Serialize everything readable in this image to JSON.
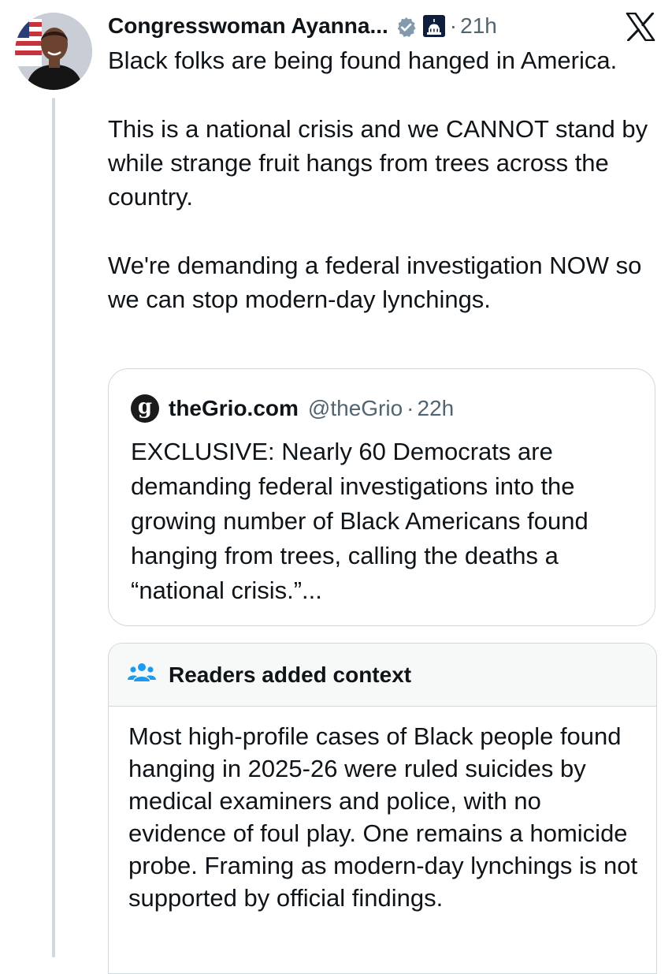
{
  "tweet": {
    "author_name": "Congresswoman Ayanna...",
    "time_ago": "21h",
    "separator": "·",
    "paragraphs": [
      "Black folks are being found hanged in America.",
      "This is a national crisis and we CANNOT stand by while strange fruit hangs from trees across the country.",
      "We're demanding a federal investigation NOW so we can stop modern-day lynchings."
    ],
    "icons": {
      "verified": "verified-badge-icon",
      "affiliation": "capitol-building-icon",
      "platform": "x-logo-icon"
    }
  },
  "quoted_tweet": {
    "logo_letter": "g",
    "name": "theGrio.com",
    "handle": "@theGrio",
    "time_ago": "22h",
    "separator": "·",
    "text": "EXCLUSIVE: Nearly 60 Democrats are demanding federal investigations into the growing number of Black Americans found hanging from trees, calling the deaths a “national crisis.”..."
  },
  "community_note": {
    "title": "Readers added context",
    "icon": "people-group-icon",
    "body": "Most high-profile cases of Black people found hanging in 2025-26 were ruled suicides by medical examiners and police, with no evidence of foul play. One remains a homicide probe. Framing as modern-day lynchings is not supported by official findings."
  },
  "colors": {
    "text": "#0f1419",
    "secondary_text": "#536471",
    "border": "#cfd9de",
    "note_icon": "#1d9bf0",
    "note_header_bg": "#f7f9f9"
  }
}
